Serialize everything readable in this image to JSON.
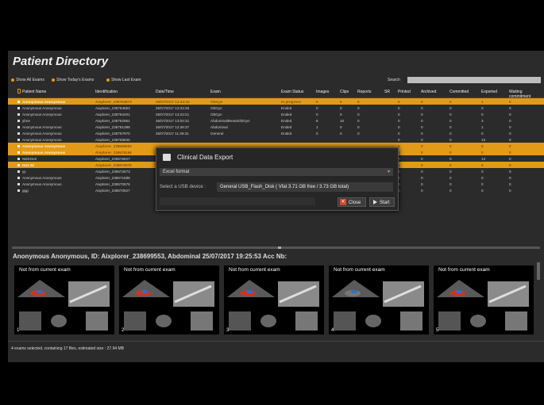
{
  "app": {
    "title": "Patient Directory"
  },
  "filters": [
    {
      "label": "Show All Exams",
      "color": "#e39a16"
    },
    {
      "label": "Show Today's Exams",
      "color": "#e39a16"
    },
    {
      "label": "Show Last Exam",
      "color": "#e39a16"
    }
  ],
  "search": {
    "label": "Search",
    "value": ""
  },
  "table": {
    "columns": [
      "Patient Name",
      "Identification",
      "Date/Time",
      "Exam",
      "Exam Status",
      "Images",
      "Clips",
      "Reports",
      "SR",
      "Printed",
      "Archived",
      "Committed",
      "Exported",
      "Waiting commitment"
    ],
    "rows": [
      {
        "cells": [
          "Anonymous Anonymous",
          "Aixplorer_238764873",
          "26/07/2017 13:34:34",
          "ObGyn",
          "In progress",
          "5",
          "0",
          "0",
          "",
          "0",
          "0",
          "0",
          "1",
          "0"
        ],
        "highlight": true
      },
      {
        "cells": [
          "Anonymous Anonymous",
          "Aixplorer_238764853",
          "26/07/2017 13:33:35",
          "ObGyn",
          "Ended",
          "0",
          "0",
          "0",
          "",
          "0",
          "0",
          "0",
          "0",
          "0"
        ],
        "highlight": false
      },
      {
        "cells": [
          "Anonymous Anonymous",
          "Aixplorer_238764201",
          "26/07/2017 13:23:21",
          "ObGyn",
          "Ended",
          "0",
          "0",
          "0",
          "",
          "0",
          "0",
          "0",
          "0",
          "0"
        ],
        "highlight": false
      },
      {
        "cells": [
          "ybne",
          "Aixplorer_238762951",
          "26/07/2017 13:02:31",
          "AbdominalBreastObGyn",
          "Ended",
          "8",
          "10",
          "0",
          "",
          "0",
          "0",
          "0",
          "3",
          "0"
        ],
        "highlight": false
      },
      {
        "cells": [
          "Anonymous Anonymous",
          "Aixplorer_238761388",
          "26/07/2017 12:36:37",
          "Abdominal",
          "Ended",
          "1",
          "0",
          "0",
          "",
          "0",
          "0",
          "0",
          "1",
          "0"
        ],
        "highlight": false
      },
      {
        "cells": [
          "Anonymous Anonymous",
          "Aixplorer_238757970",
          "26/07/2017 11:39:31",
          "General",
          "Ended",
          "0",
          "0",
          "0",
          "",
          "0",
          "0",
          "0",
          "0",
          "0"
        ],
        "highlight": false
      },
      {
        "cells": [
          "Anonymous Anonymous",
          "Aixplorer_238756845",
          "",
          "",
          "",
          "",
          "",
          "",
          "",
          "0",
          "0",
          "0",
          "13",
          "0"
        ],
        "highlight": false
      },
      {
        "cells": [
          "Anonymous Anonymous",
          "Aixplorer_238699553",
          "",
          "",
          "",
          "",
          "",
          "",
          "",
          "0",
          "0",
          "0",
          "8",
          "0"
        ],
        "highlight": true
      },
      {
        "cells": [
          "Anonymous Anonymous",
          "Aixplorer_238678196",
          "",
          "",
          "",
          "",
          "",
          "",
          "",
          "0",
          "0",
          "0",
          "0",
          "0"
        ],
        "highlight": true
      },
      {
        "cells": [
          "NEEDLE",
          "Aixplorer_238676827",
          "",
          "",
          "",
          "",
          "",
          "",
          "",
          "0",
          "0",
          "0",
          "13",
          "0"
        ],
        "highlight": false
      },
      {
        "cells": [
          "test 2d",
          "Aixplorer_238672570",
          "",
          "",
          "",
          "",
          "",
          "",
          "",
          "0",
          "0",
          "0",
          "5",
          "0"
        ],
        "highlight": true
      },
      {
        "cells": [
          "yy",
          "Aixplorer_238672873",
          "",
          "",
          "",
          "",
          "",
          "",
          "",
          "0",
          "0",
          "0",
          "0",
          "0"
        ],
        "highlight": false
      },
      {
        "cells": [
          "Anonymous Anonymous",
          "Aixplorer_238671688",
          "",
          "",
          "",
          "",
          "",
          "",
          "",
          "0",
          "0",
          "0",
          "0",
          "0"
        ],
        "highlight": false
      },
      {
        "cells": [
          "Anonymous Anonymous",
          "Aixplorer_238670676",
          "",
          "",
          "",
          "",
          "",
          "",
          "",
          "0",
          "0",
          "0",
          "0",
          "0"
        ],
        "highlight": false
      },
      {
        "cells": [
          "ggg",
          "Aixplorer_238670627",
          "",
          "",
          "",
          "",
          "",
          "",
          "",
          "0",
          "0",
          "0",
          "0",
          "0"
        ],
        "highlight": false
      }
    ]
  },
  "modal": {
    "title": "Clinical Data Export",
    "format": "Excel format",
    "usb_label": "Select a USB device :",
    "usb_value": "General USB_Flash_Disk ( Vfat 3.71 GB free / 3.73 GB total)",
    "close_label": "Close",
    "start_label": "Start"
  },
  "exam_info": "Anonymous Anonymous, ID: Aixplorer_238699553, Abdominal 25/07/2017 19:25:53 Acc Nb:",
  "thumbnails": [
    {
      "label": "Not from current exam",
      "number": "1"
    },
    {
      "label": "Not from current exam",
      "number": "2"
    },
    {
      "label": "Not from current exam",
      "number": "3"
    },
    {
      "label": "Not from current exam",
      "number": "4"
    },
    {
      "label": "Not from current exam",
      "number": "5"
    }
  ],
  "status": "4 exams selected, containing 17 files, estimated size : 27.94 MB"
}
